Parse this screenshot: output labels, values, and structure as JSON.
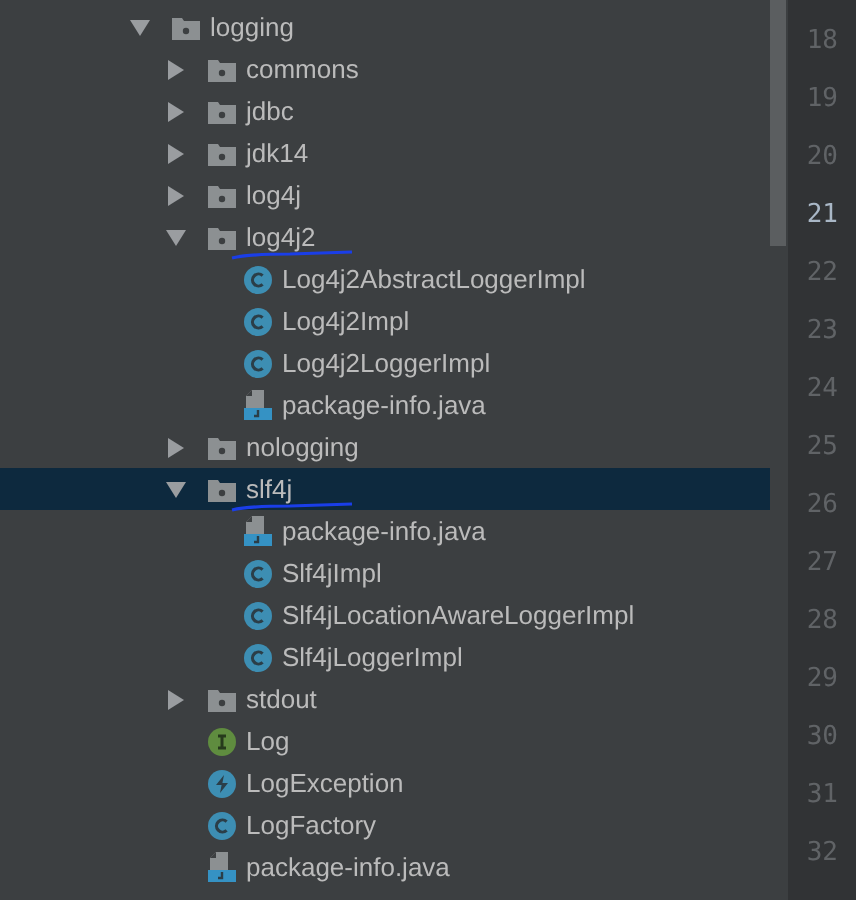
{
  "tree": [
    {
      "kind": "folder",
      "label": "logging",
      "expanded": true,
      "selected": false,
      "underlined": false,
      "children": [
        {
          "kind": "folder",
          "label": "commons",
          "expanded": false,
          "selected": false,
          "underlined": false
        },
        {
          "kind": "folder",
          "label": "jdbc",
          "expanded": false,
          "selected": false,
          "underlined": false
        },
        {
          "kind": "folder",
          "label": "jdk14",
          "expanded": false,
          "selected": false,
          "underlined": false
        },
        {
          "kind": "folder",
          "label": "log4j",
          "expanded": false,
          "selected": false,
          "underlined": false
        },
        {
          "kind": "folder",
          "label": "log4j2",
          "expanded": true,
          "selected": false,
          "underlined": true,
          "children": [
            {
              "kind": "class",
              "label": "Log4j2AbstractLoggerImpl",
              "selected": false,
              "underlined": false
            },
            {
              "kind": "class",
              "label": "Log4j2Impl",
              "selected": false,
              "underlined": false
            },
            {
              "kind": "class",
              "label": "Log4j2LoggerImpl",
              "selected": false,
              "underlined": false
            },
            {
              "kind": "file",
              "label": "package-info.java",
              "selected": false,
              "underlined": false
            }
          ]
        },
        {
          "kind": "folder",
          "label": "nologging",
          "expanded": false,
          "selected": false,
          "underlined": false
        },
        {
          "kind": "folder",
          "label": "slf4j",
          "expanded": true,
          "selected": true,
          "underlined": true,
          "children": [
            {
              "kind": "file",
              "label": "package-info.java",
              "selected": false,
              "underlined": false
            },
            {
              "kind": "class",
              "label": "Slf4jImpl",
              "selected": false,
              "underlined": false
            },
            {
              "kind": "class",
              "label": "Slf4jLocationAwareLoggerImpl",
              "selected": false,
              "underlined": false
            },
            {
              "kind": "class",
              "label": "Slf4jLoggerImpl",
              "selected": false,
              "underlined": false
            }
          ]
        },
        {
          "kind": "folder",
          "label": "stdout",
          "expanded": false,
          "selected": false,
          "underlined": false
        },
        {
          "kind": "interface",
          "label": "Log",
          "selected": false,
          "underlined": false
        },
        {
          "kind": "exception",
          "label": "LogException",
          "selected": false,
          "underlined": false
        },
        {
          "kind": "class",
          "label": "LogFactory",
          "selected": false,
          "underlined": false
        },
        {
          "kind": "file",
          "label": "package-info.java",
          "selected": false,
          "underlined": false
        }
      ]
    }
  ],
  "gutter": {
    "lines": [
      {
        "number": "18",
        "current": false
      },
      {
        "number": "19",
        "current": false
      },
      {
        "number": "20",
        "current": false
      },
      {
        "number": "21",
        "current": true
      },
      {
        "number": "22",
        "current": false
      },
      {
        "number": "23",
        "current": false
      },
      {
        "number": "24",
        "current": false
      },
      {
        "number": "25",
        "current": false
      },
      {
        "number": "26",
        "current": false
      },
      {
        "number": "27",
        "current": false
      },
      {
        "number": "28",
        "current": false
      },
      {
        "number": "29",
        "current": false
      },
      {
        "number": "30",
        "current": false
      },
      {
        "number": "31",
        "current": false
      },
      {
        "number": "32",
        "current": false
      }
    ]
  }
}
